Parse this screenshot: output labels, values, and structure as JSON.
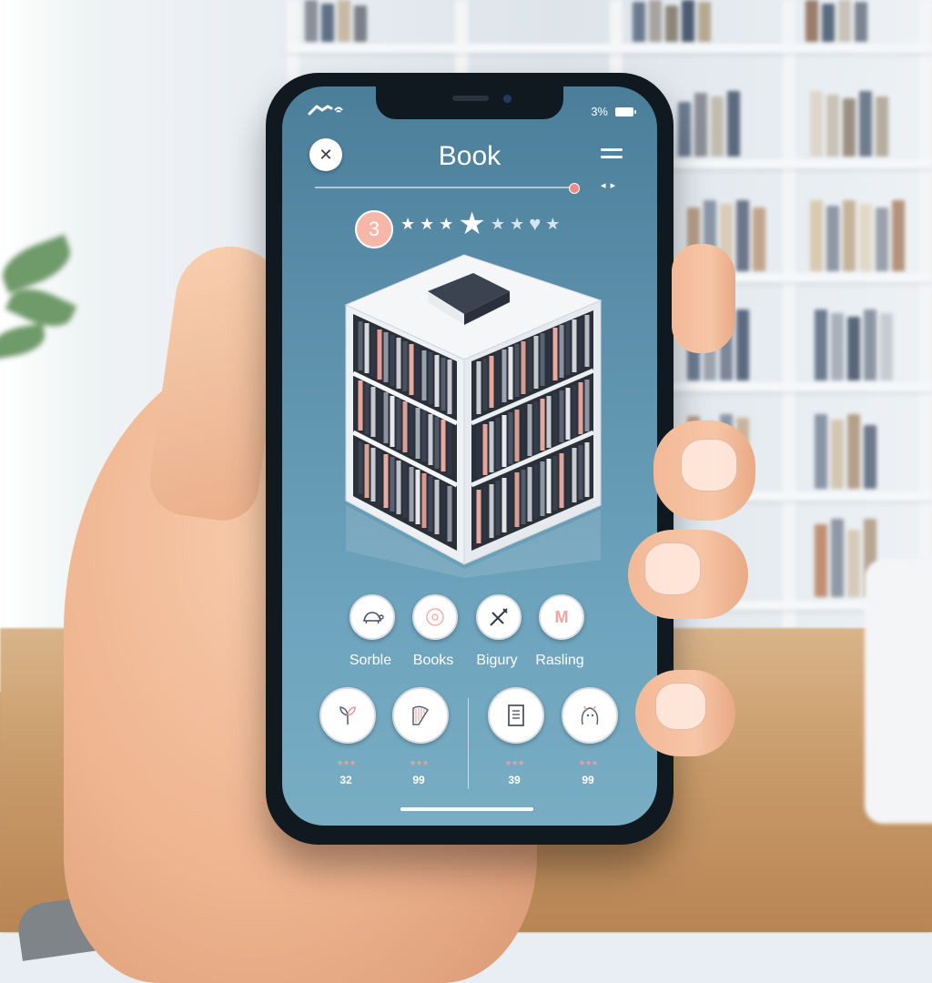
{
  "status_bar": {
    "battery_text": "3%",
    "battery_icon": "battery-icon",
    "signal_icon": "signal-icon"
  },
  "header": {
    "title": "Book",
    "close_icon": "close-icon",
    "menu_icon": "hamburger-menu-icon"
  },
  "media": {
    "progress": 0.98,
    "audio_icon": "volume-icon"
  },
  "rating": {
    "badge": "3",
    "icons": [
      "star",
      "star",
      "star",
      "star-large",
      "star",
      "star",
      "heart",
      "star"
    ]
  },
  "model_icon": "bookshelf-cube-3d",
  "categories": [
    {
      "label": "Sorble",
      "icon": "turtle-icon"
    },
    {
      "label": "Books",
      "icon": "circle-icon"
    },
    {
      "label": "Bigury",
      "icon": "crossed-tools-icon"
    },
    {
      "label": "Rasling",
      "icon": "letter-m-icon"
    }
  ],
  "stats": [
    {
      "icon": "plant-icon",
      "value": "32"
    },
    {
      "icon": "harp-icon",
      "value": "99"
    },
    {
      "icon": "document-icon",
      "value": "39"
    },
    {
      "icon": "creature-icon",
      "value": "99"
    }
  ],
  "colors": {
    "screen_top": "#4b7e99",
    "screen_bottom": "#78adc4",
    "accent_pink": "#f6b7a8",
    "progress_dot": "#f08a8a"
  }
}
